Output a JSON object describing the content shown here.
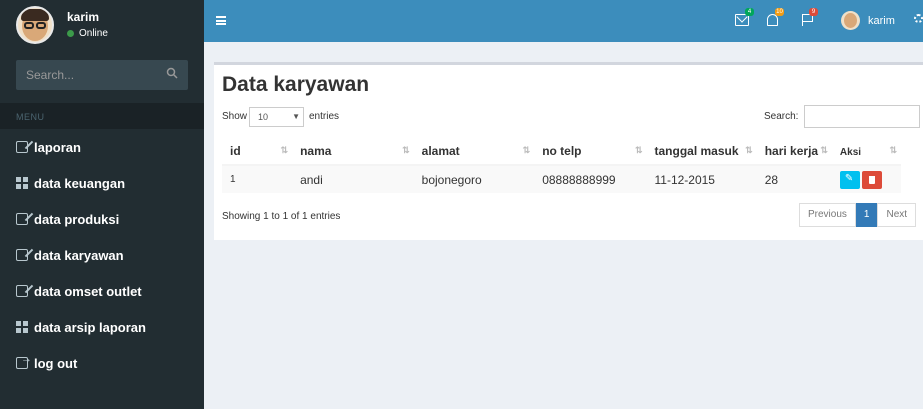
{
  "sidebar": {
    "user": {
      "name": "karim",
      "status": "Online"
    },
    "search_placeholder": "Search...",
    "menu_header": "MENU",
    "items": [
      {
        "label": "laporan",
        "icon": "edit-icon"
      },
      {
        "label": "data keuangan",
        "icon": "table-icon"
      },
      {
        "label": "data produksi",
        "icon": "edit-icon"
      },
      {
        "label": "data karyawan",
        "icon": "edit-icon"
      },
      {
        "label": "data omset outlet",
        "icon": "edit-icon"
      },
      {
        "label": "data arsip laporan",
        "icon": "table-icon"
      },
      {
        "label": "log out",
        "icon": "sign-out-icon"
      }
    ]
  },
  "topbar": {
    "user_name": "karim",
    "badges": {
      "messages": "4",
      "notifications": "10",
      "tasks": "9"
    }
  },
  "main": {
    "title": "Data karyawan",
    "show_label": "Show",
    "page_length": "10",
    "entries_label": "entries",
    "search_label": "Search:",
    "search_value": "",
    "columns": [
      "id",
      "nama",
      "alamat",
      "no telp",
      "tanggal masuk",
      "hari kerja",
      "Aksi"
    ],
    "rows": [
      {
        "id": "1",
        "nama": "andi",
        "alamat": "bojonegoro",
        "no_telp": "08888888999",
        "tanggal_masuk": "11-12-2015",
        "hari_kerja": "28"
      }
    ],
    "info": "Showing 1 to 1 of 1 entries",
    "pager": {
      "previous": "Previous",
      "current": "1",
      "next": "Next"
    }
  },
  "colors": {
    "sidebar_bg": "#222d32",
    "header_bg": "#3c8dbc",
    "edit_button": "#00c0ef",
    "delete_button": "#dd4b39",
    "pager_active": "#337ab7"
  }
}
